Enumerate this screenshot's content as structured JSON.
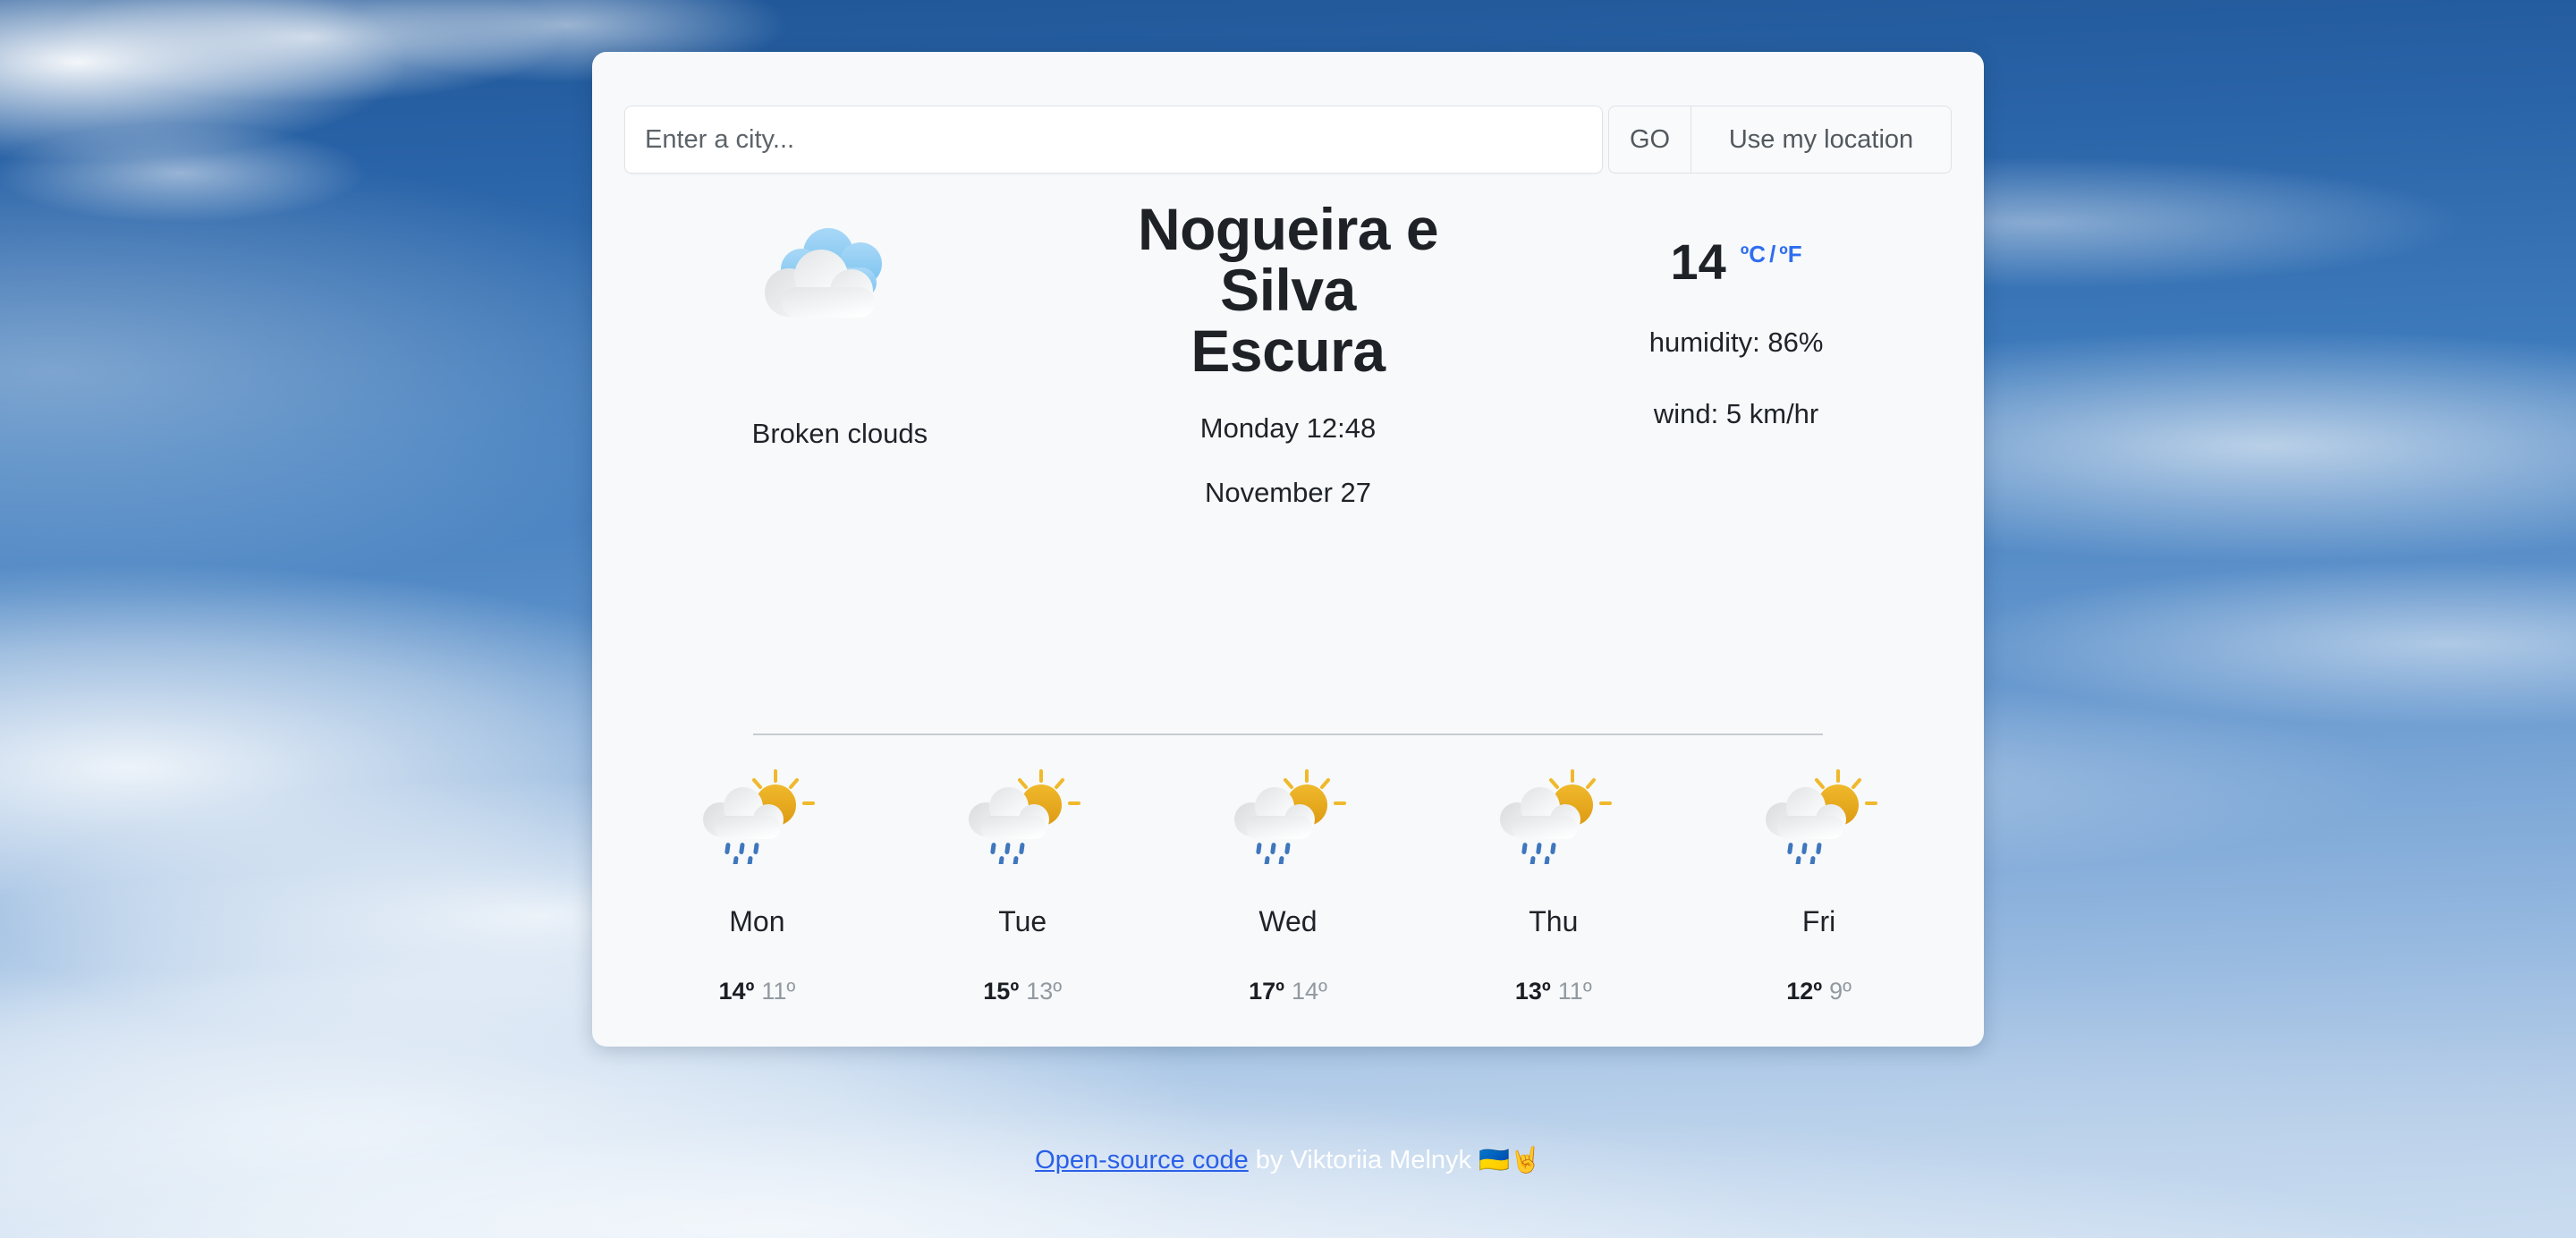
{
  "search": {
    "placeholder": "Enter a city...",
    "value": "",
    "go_label": "GO",
    "geolocate_label": "Use my location"
  },
  "current": {
    "icon": "broken-clouds-icon",
    "condition": "Broken clouds",
    "city": "Nogueira e Silva Escura",
    "time": "Monday 12:48",
    "date": "November 27",
    "temperature": "14",
    "unit_celsius": "ºC",
    "unit_separator": "/",
    "unit_fahrenheit": "ºF",
    "humidity": "humidity: 86%",
    "wind": "wind: 5 km/hr"
  },
  "forecast": [
    {
      "day": "Mon",
      "icon": "sun-cloud-rain-icon",
      "max": "14º",
      "min": "11º"
    },
    {
      "day": "Tue",
      "icon": "sun-cloud-rain-icon",
      "max": "15º",
      "min": "13º"
    },
    {
      "day": "Wed",
      "icon": "sun-cloud-rain-icon",
      "max": "17º",
      "min": "14º"
    },
    {
      "day": "Thu",
      "icon": "sun-cloud-rain-icon",
      "max": "13º",
      "min": "11º"
    },
    {
      "day": "Fri",
      "icon": "sun-cloud-rain-icon",
      "max": "12º",
      "min": "9º"
    }
  ],
  "footer": {
    "link_text": "Open-source code",
    "credit_text": " by Viktoriia Melnyk ",
    "flag_emoji": "🇺🇦",
    "hand_emoji": "🤘"
  },
  "colors": {
    "accent_blue": "#2f6df0",
    "link_blue": "#2a5fe8",
    "card_bg": "#f7f9fb",
    "sky_blue": "#2f6aab",
    "sun_yellow": "#e8a723",
    "rain_blue": "#3f77bd",
    "text_dark": "#1e2227",
    "text_muted": "#9299a0"
  }
}
